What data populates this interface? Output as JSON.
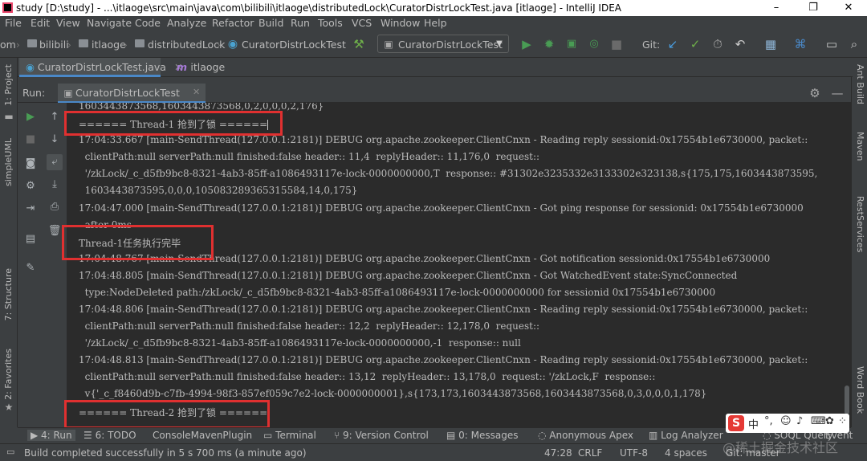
{
  "title": "study [D:\\study] - ...\\itlaoge\\src\\main\\java\\com\\bilibili\\itlaoge\\distributedLock\\CuratorDistrLockTest.java [itlaoge] - IntelliJ IDEA",
  "window_controls": [
    "–",
    "❐",
    "✕"
  ],
  "menu": [
    "File",
    "Edit",
    "View",
    "Navigate",
    "Code",
    "Analyze",
    "Refactor",
    "Build",
    "Run",
    "Tools",
    "VCS",
    "Window",
    "Help"
  ],
  "breadcrumb": [
    "om",
    "bilibili",
    "itlaoge",
    "distributedLock",
    "CuratorDistrLockTest"
  ],
  "run_config": "CuratorDistrLockTest",
  "git_label": "Git:",
  "editor_tabs": [
    "CuratorDistrLockTest.java",
    "itlaoge"
  ],
  "left_strip": [
    "1: Project",
    "simpleUML",
    "7: Structure",
    "2: Favorites"
  ],
  "right_strip": [
    "Ant Build",
    "Maven",
    "RestServices",
    "Word Book"
  ],
  "run_label": "Run:",
  "run_tab": "CuratorDistrLockTest",
  "console_lines": [
    "1603443873568,1603443873568,0,2,0,0,0,2,176}",
    "====== Thread-1 抢到了锁 ======",
    "17:04:33.667 [main-SendThread(127.0.0.1:2181)] DEBUG org.apache.zookeeper.ClientCnxn - Reading reply sessionid:0x17554b1e6730000, packet::",
    "  clientPath:null serverPath:null finished:false header:: 11,4  replyHeader:: 11,176,0  request::",
    "  '/zkLock/_c_d5fb9bc8-8321-4ab3-85ff-a1086493117e-lock-0000000000,T  response:: #31302e3235332e3133302e323138,s{175,175,1603443873595,",
    "  1603443873595,0,0,0,105083289365315584,14,0,175}",
    "17:04:47.000 [main-SendThread(127.0.0.1:2181)] DEBUG org.apache.zookeeper.ClientCnxn - Got ping response for sessionid: 0x17554b1e6730000",
    "  after 0ms",
    "Thread-1任务执行完毕",
    "17:04:48.767 [main-SendThread(127.0.0.1:2181)] DEBUG org.apache.zookeeper.ClientCnxn - Got notification sessionid:0x17554b1e6730000",
    "17:04:48.805 [main-SendThread(127.0.0.1:2181)] DEBUG org.apache.zookeeper.ClientCnxn - Got WatchedEvent state:SyncConnected",
    "  type:NodeDeleted path:/zkLock/_c_d5fb9bc8-8321-4ab3-85ff-a1086493117e-lock-0000000000 for sessionid 0x17554b1e6730000",
    "17:04:48.806 [main-SendThread(127.0.0.1:2181)] DEBUG org.apache.zookeeper.ClientCnxn - Reading reply sessionid:0x17554b1e6730000, packet::",
    "  clientPath:null serverPath:null finished:false header:: 12,2  replyHeader:: 12,178,0  request::",
    "  '/zkLock/_c_d5fb9bc8-8321-4ab3-85ff-a1086493117e-lock-0000000000,-1  response:: null",
    "17:04:48.813 [main-SendThread(127.0.0.1:2181)] DEBUG org.apache.zookeeper.ClientCnxn - Reading reply sessionid:0x17554b1e6730000, packet::",
    "  clientPath:null serverPath:null finished:false header:: 13,12  replyHeader:: 13,178,0  request:: '/zkLock,F  response::",
    "  v{'_c_f8460d9b-c7fb-4994-98f3-857ef059c7e2-lock-0000000001},s{173,173,1603443873568,1603443873568,0,3,0,0,0,1,178}",
    "====== Thread-2 抢到了锁 ======"
  ],
  "bottom_tabs": [
    "4: Run",
    "6: TODO",
    "ConsoleMavenPlugin",
    "Terminal",
    "9: Version Control",
    "0: Messages",
    "Anonymous Apex",
    "Log Analyzer",
    "SOQL Query",
    "Event"
  ],
  "status": {
    "message": "Build completed successfully in 5 s 700 ms (a minute ago)",
    "position": "47:28",
    "line_sep": "CRLF",
    "encoding": "UTF-8",
    "indent": "4 spaces",
    "git": "Git: master"
  },
  "ime": "中",
  "watermark": "@稀土掘金技术社区",
  "colors": {
    "accent": "#4a88c7",
    "highlight_box": "#e03030",
    "console_bg": "#2b2b2b",
    "ui_bg": "#3c3f41",
    "run_green": "#499c54"
  }
}
